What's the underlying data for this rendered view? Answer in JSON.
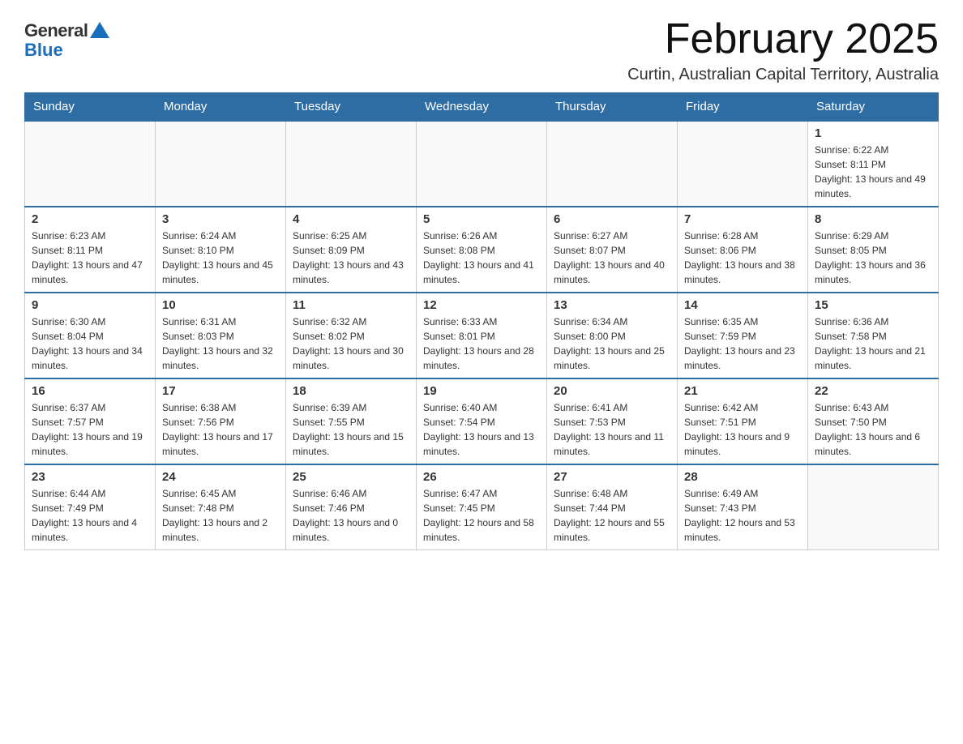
{
  "header": {
    "logo": {
      "general": "General",
      "blue": "Blue"
    },
    "title": "February 2025",
    "location": "Curtin, Australian Capital Territory, Australia"
  },
  "calendar": {
    "days_of_week": [
      "Sunday",
      "Monday",
      "Tuesday",
      "Wednesday",
      "Thursday",
      "Friday",
      "Saturday"
    ],
    "weeks": [
      [
        {
          "day": "",
          "info": ""
        },
        {
          "day": "",
          "info": ""
        },
        {
          "day": "",
          "info": ""
        },
        {
          "day": "",
          "info": ""
        },
        {
          "day": "",
          "info": ""
        },
        {
          "day": "",
          "info": ""
        },
        {
          "day": "1",
          "info": "Sunrise: 6:22 AM\nSunset: 8:11 PM\nDaylight: 13 hours and 49 minutes."
        }
      ],
      [
        {
          "day": "2",
          "info": "Sunrise: 6:23 AM\nSunset: 8:11 PM\nDaylight: 13 hours and 47 minutes."
        },
        {
          "day": "3",
          "info": "Sunrise: 6:24 AM\nSunset: 8:10 PM\nDaylight: 13 hours and 45 minutes."
        },
        {
          "day": "4",
          "info": "Sunrise: 6:25 AM\nSunset: 8:09 PM\nDaylight: 13 hours and 43 minutes."
        },
        {
          "day": "5",
          "info": "Sunrise: 6:26 AM\nSunset: 8:08 PM\nDaylight: 13 hours and 41 minutes."
        },
        {
          "day": "6",
          "info": "Sunrise: 6:27 AM\nSunset: 8:07 PM\nDaylight: 13 hours and 40 minutes."
        },
        {
          "day": "7",
          "info": "Sunrise: 6:28 AM\nSunset: 8:06 PM\nDaylight: 13 hours and 38 minutes."
        },
        {
          "day": "8",
          "info": "Sunrise: 6:29 AM\nSunset: 8:05 PM\nDaylight: 13 hours and 36 minutes."
        }
      ],
      [
        {
          "day": "9",
          "info": "Sunrise: 6:30 AM\nSunset: 8:04 PM\nDaylight: 13 hours and 34 minutes."
        },
        {
          "day": "10",
          "info": "Sunrise: 6:31 AM\nSunset: 8:03 PM\nDaylight: 13 hours and 32 minutes."
        },
        {
          "day": "11",
          "info": "Sunrise: 6:32 AM\nSunset: 8:02 PM\nDaylight: 13 hours and 30 minutes."
        },
        {
          "day": "12",
          "info": "Sunrise: 6:33 AM\nSunset: 8:01 PM\nDaylight: 13 hours and 28 minutes."
        },
        {
          "day": "13",
          "info": "Sunrise: 6:34 AM\nSunset: 8:00 PM\nDaylight: 13 hours and 25 minutes."
        },
        {
          "day": "14",
          "info": "Sunrise: 6:35 AM\nSunset: 7:59 PM\nDaylight: 13 hours and 23 minutes."
        },
        {
          "day": "15",
          "info": "Sunrise: 6:36 AM\nSunset: 7:58 PM\nDaylight: 13 hours and 21 minutes."
        }
      ],
      [
        {
          "day": "16",
          "info": "Sunrise: 6:37 AM\nSunset: 7:57 PM\nDaylight: 13 hours and 19 minutes."
        },
        {
          "day": "17",
          "info": "Sunrise: 6:38 AM\nSunset: 7:56 PM\nDaylight: 13 hours and 17 minutes."
        },
        {
          "day": "18",
          "info": "Sunrise: 6:39 AM\nSunset: 7:55 PM\nDaylight: 13 hours and 15 minutes."
        },
        {
          "day": "19",
          "info": "Sunrise: 6:40 AM\nSunset: 7:54 PM\nDaylight: 13 hours and 13 minutes."
        },
        {
          "day": "20",
          "info": "Sunrise: 6:41 AM\nSunset: 7:53 PM\nDaylight: 13 hours and 11 minutes."
        },
        {
          "day": "21",
          "info": "Sunrise: 6:42 AM\nSunset: 7:51 PM\nDaylight: 13 hours and 9 minutes."
        },
        {
          "day": "22",
          "info": "Sunrise: 6:43 AM\nSunset: 7:50 PM\nDaylight: 13 hours and 6 minutes."
        }
      ],
      [
        {
          "day": "23",
          "info": "Sunrise: 6:44 AM\nSunset: 7:49 PM\nDaylight: 13 hours and 4 minutes."
        },
        {
          "day": "24",
          "info": "Sunrise: 6:45 AM\nSunset: 7:48 PM\nDaylight: 13 hours and 2 minutes."
        },
        {
          "day": "25",
          "info": "Sunrise: 6:46 AM\nSunset: 7:46 PM\nDaylight: 13 hours and 0 minutes."
        },
        {
          "day": "26",
          "info": "Sunrise: 6:47 AM\nSunset: 7:45 PM\nDaylight: 12 hours and 58 minutes."
        },
        {
          "day": "27",
          "info": "Sunrise: 6:48 AM\nSunset: 7:44 PM\nDaylight: 12 hours and 55 minutes."
        },
        {
          "day": "28",
          "info": "Sunrise: 6:49 AM\nSunset: 7:43 PM\nDaylight: 12 hours and 53 minutes."
        },
        {
          "day": "",
          "info": ""
        }
      ]
    ]
  }
}
